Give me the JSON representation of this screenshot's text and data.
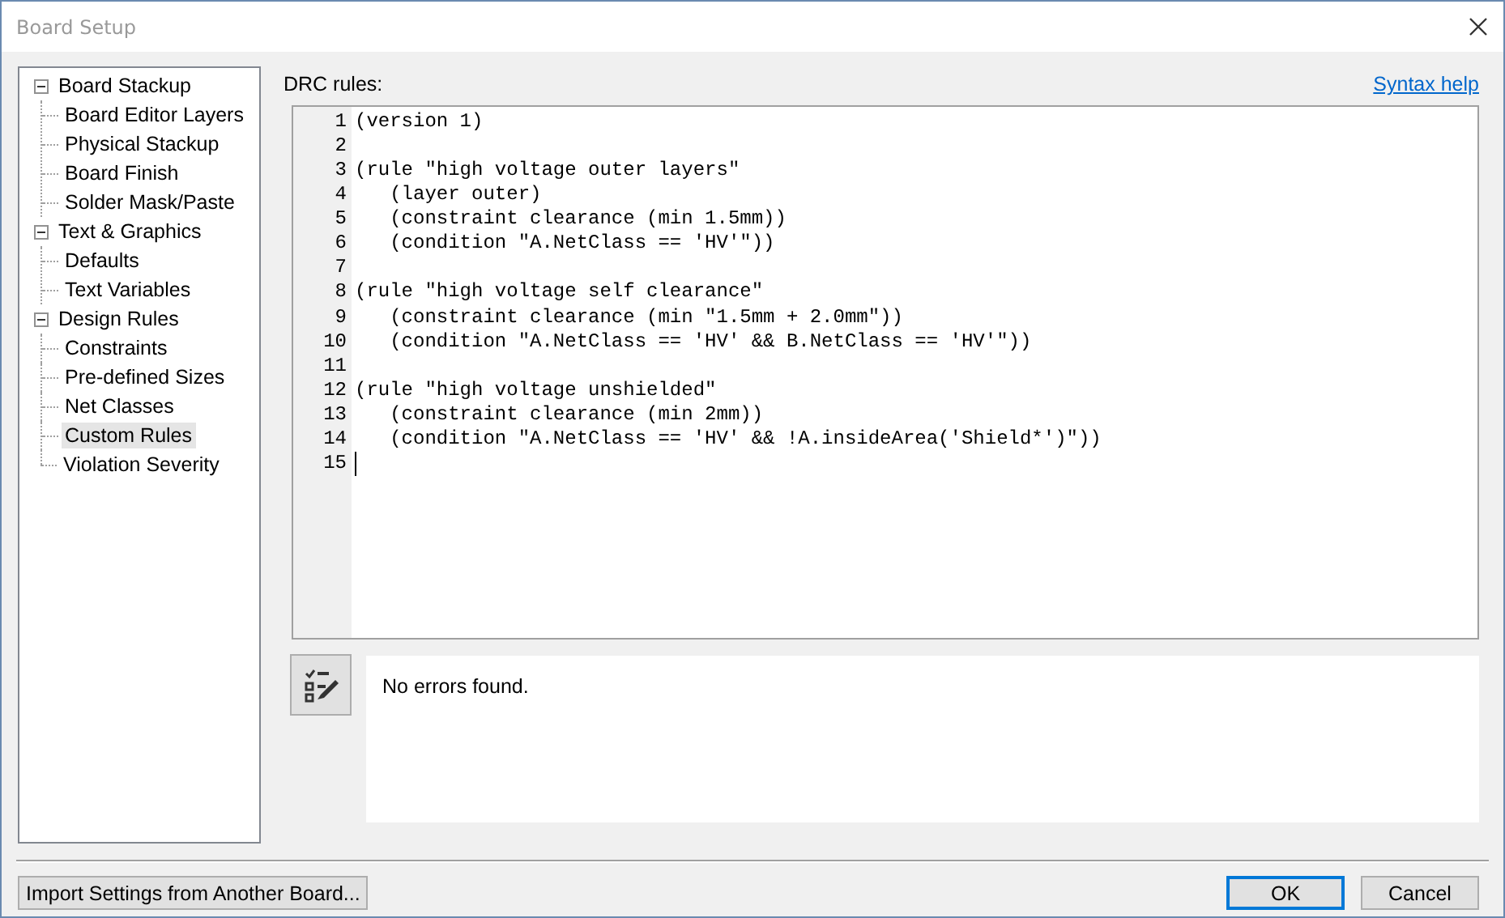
{
  "window": {
    "title": "Board Setup"
  },
  "sidebar": {
    "items": [
      {
        "label": "Board Stackup",
        "selected": false,
        "expanded": true,
        "children": [
          {
            "label": "Board Editor Layers",
            "selected": false
          },
          {
            "label": "Physical Stackup",
            "selected": false
          },
          {
            "label": "Board Finish",
            "selected": false
          },
          {
            "label": "Solder Mask/Paste",
            "selected": false
          }
        ]
      },
      {
        "label": "Text & Graphics",
        "selected": false,
        "expanded": true,
        "children": [
          {
            "label": "Defaults",
            "selected": false
          },
          {
            "label": "Text Variables",
            "selected": false
          }
        ]
      },
      {
        "label": "Design Rules",
        "selected": false,
        "expanded": true,
        "children": [
          {
            "label": "Constraints",
            "selected": false
          },
          {
            "label": "Pre-defined Sizes",
            "selected": false
          },
          {
            "label": "Net Classes",
            "selected": false
          },
          {
            "label": "Custom Rules",
            "selected": true
          },
          {
            "label": "Violation Severity",
            "selected": false
          }
        ]
      }
    ]
  },
  "editor": {
    "label": "DRC rules:",
    "help_link": "Syntax help",
    "lines": [
      {
        "number": "1",
        "text": "(version 1)",
        "cursor": false
      },
      {
        "number": "2",
        "cursor": false
      },
      {
        "number": "3",
        "text": "(rule \"high voltage outer layers\"",
        "cursor": false
      },
      {
        "number": "4",
        "text": "   (layer outer)",
        "cursor": false
      },
      {
        "number": "5",
        "text": "   (constraint clearance (min 1.5mm))",
        "cursor": false
      },
      {
        "number": "6",
        "text": "   (condition \"A.NetClass == 'HV'\"))",
        "cursor": false
      },
      {
        "number": "7",
        "cursor": false
      },
      {
        "number": "8",
        "text": "(rule \"high voltage self clearance\"",
        "cursor": false
      },
      {
        "number": "9",
        "text": "   (constraint clearance (min \"1.5mm + 2.0mm\"))",
        "cursor": false
      },
      {
        "number": "10",
        "text": "   (condition \"A.NetClass == 'HV' && B.NetClass == 'HV'\"))",
        "cursor": false
      },
      {
        "number": "11",
        "cursor": false
      },
      {
        "number": "12",
        "text": "(rule \"high voltage unshielded\"",
        "cursor": false
      },
      {
        "number": "13",
        "text": "   (constraint clearance (min 2mm))",
        "cursor": false
      },
      {
        "number": "14",
        "text": "   (condition \"A.NetClass == 'HV' && !A.insideArea('Shield*')\"))",
        "cursor": false
      },
      {
        "number": "15",
        "cursor": true
      }
    ]
  },
  "messages": {
    "text": "No errors found."
  },
  "buttons": [
    {
      "label": "Import Settings from Another Board...",
      "default": false
    },
    {
      "label": "OK",
      "default": true
    },
    {
      "label": "Cancel",
      "default": false
    }
  ]
}
